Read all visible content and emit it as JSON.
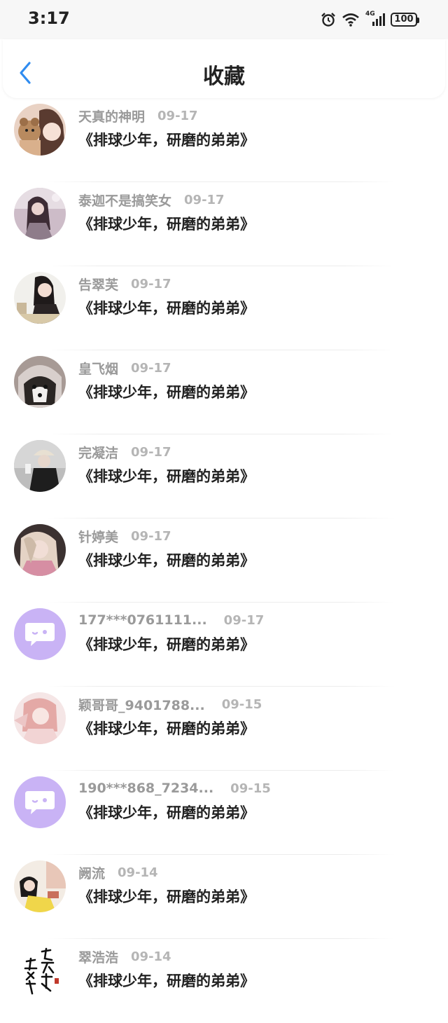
{
  "status_bar": {
    "time": "3:17",
    "network": "4G",
    "battery": "100"
  },
  "header": {
    "title": "收藏"
  },
  "favorites": [
    {
      "user": "天真的神明",
      "date": "09-17",
      "title": "《排球少年，研磨的弟弟》",
      "avatar": "photo"
    },
    {
      "user": "泰迦不是搞笑女",
      "date": "09-17",
      "title": "《排球少年，研磨的弟弟》",
      "avatar": "photo"
    },
    {
      "user": "告翠芙",
      "date": "09-17",
      "title": "《排球少年，研磨的弟弟》",
      "avatar": "photo"
    },
    {
      "user": "皇飞烟",
      "date": "09-17",
      "title": "《排球少年，研磨的弟弟》",
      "avatar": "photo"
    },
    {
      "user": "完凝洁",
      "date": "09-17",
      "title": "《排球少年，研磨的弟弟》",
      "avatar": "photo"
    },
    {
      "user": "针婷美",
      "date": "09-17",
      "title": "《排球少年，研磨的弟弟》",
      "avatar": "photo"
    },
    {
      "user": "177***0761111...",
      "date": "09-17",
      "title": "《排球少年，研磨的弟弟》",
      "avatar": "default-chat-icon"
    },
    {
      "user": "颖哥哥_9401788...",
      "date": "09-15",
      "title": "《排球少年，研磨的弟弟》",
      "avatar": "photo"
    },
    {
      "user": "190***868_7234...",
      "date": "09-15",
      "title": "《排球少年，研磨的弟弟》",
      "avatar": "default-chat-icon"
    },
    {
      "user": "阙流",
      "date": "09-14",
      "title": "《排球少年，研磨的弟弟》",
      "avatar": "photo"
    },
    {
      "user": "翠浩浩",
      "date": "09-14",
      "title": "《排球少年，研磨的弟弟》",
      "avatar": "calligraphy"
    }
  ],
  "colors": {
    "accent": "#2f8cf0",
    "username": "#9a9a9a",
    "date": "#b5b5b5",
    "title": "#222222",
    "default_avatar": "#c9b3f5"
  }
}
